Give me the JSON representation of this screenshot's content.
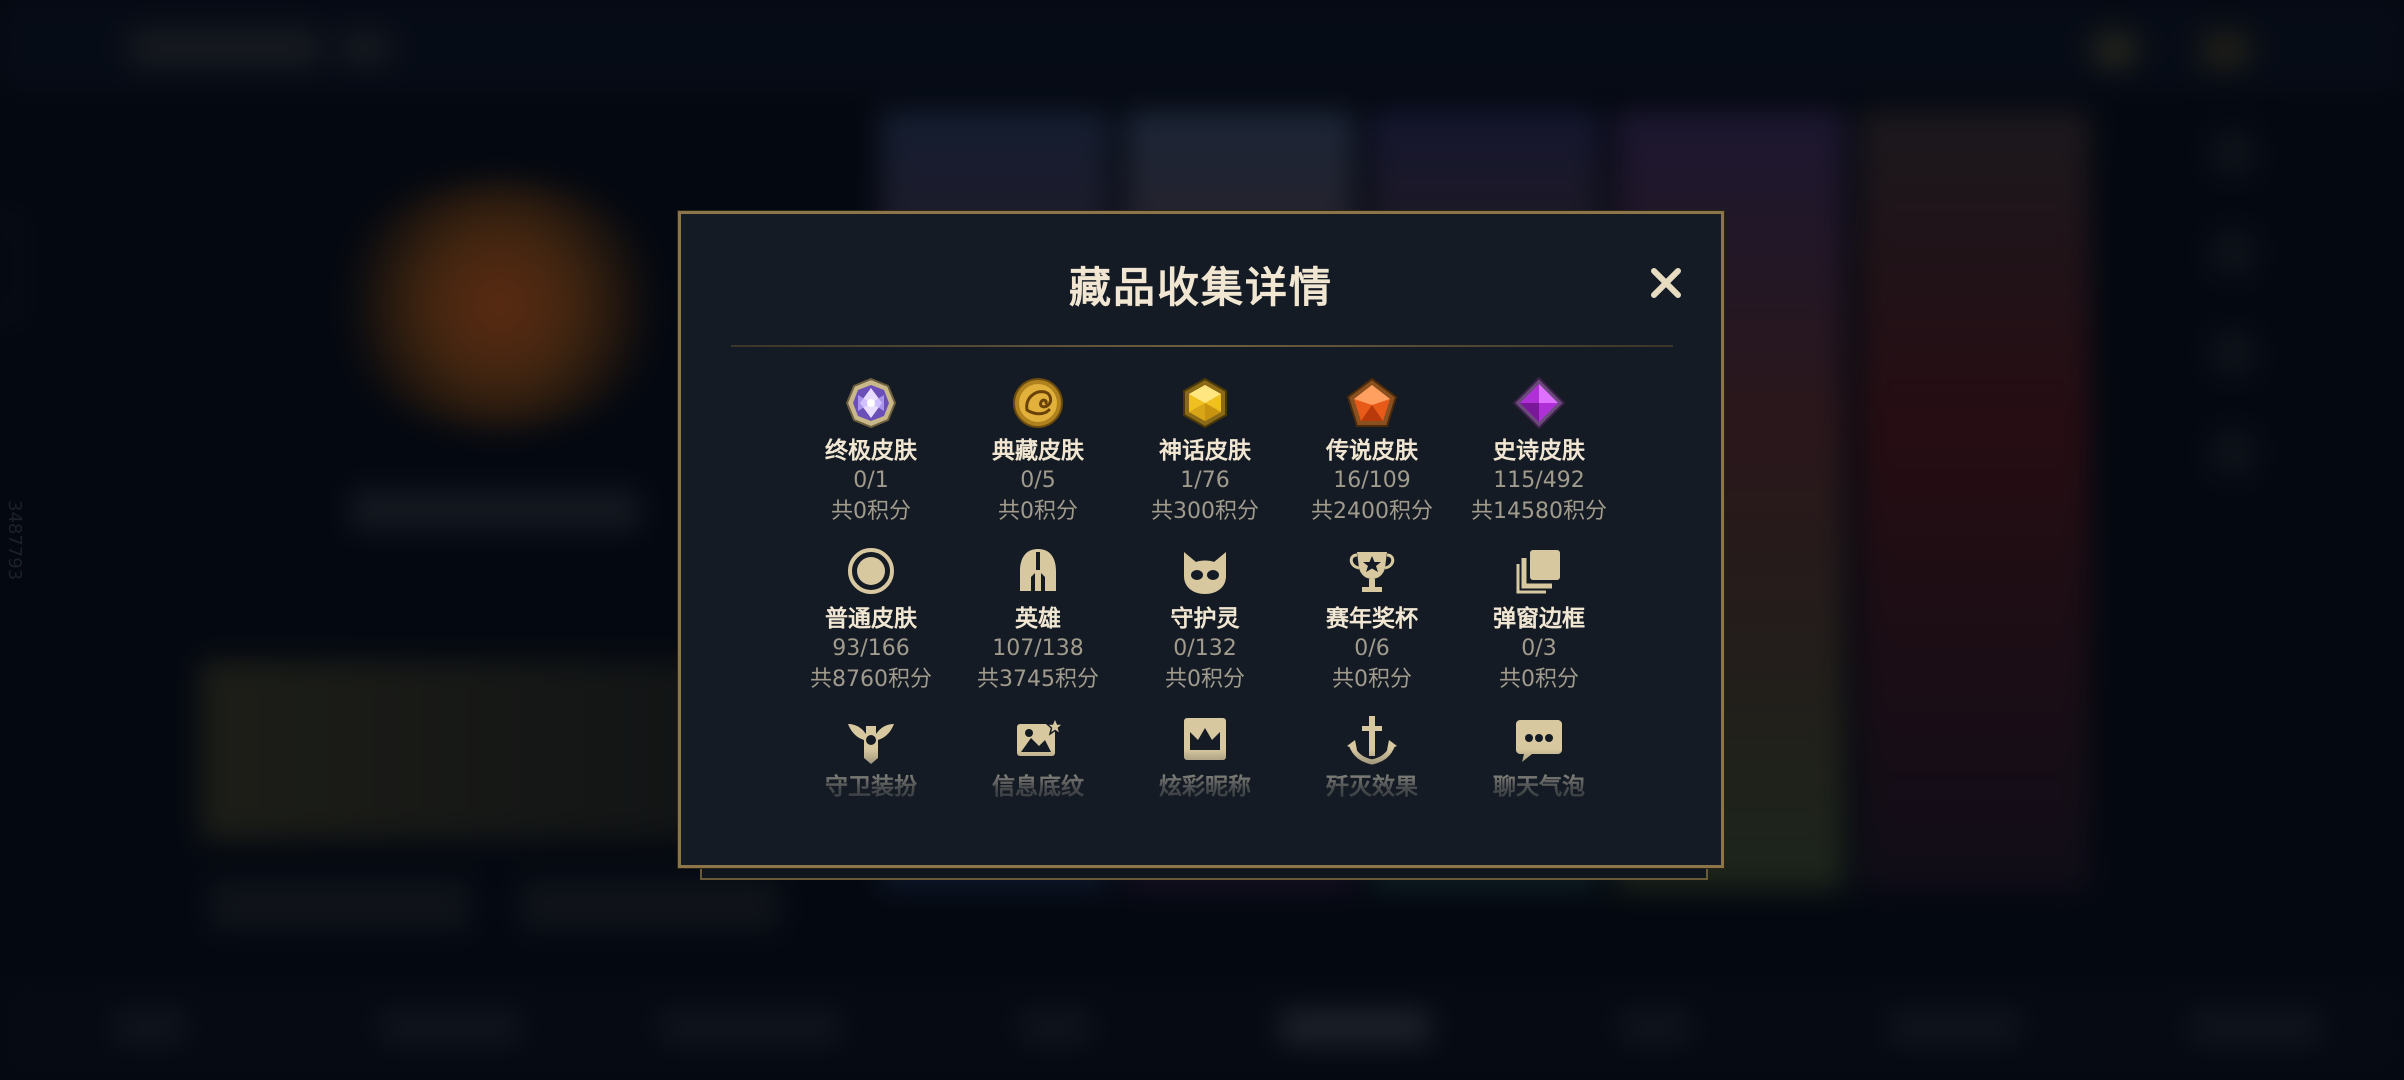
{
  "background": {
    "side_id": "3487793"
  },
  "modal": {
    "title": "藏品收集详情",
    "close_label": "✕",
    "items": [
      {
        "name": "终极皮肤",
        "count": "0/1",
        "points": "共0积分",
        "icon": "ultimate-gem-icon"
      },
      {
        "name": "典藏皮肤",
        "count": "0/5",
        "points": "共0积分",
        "icon": "dragon-coin-icon"
      },
      {
        "name": "神话皮肤",
        "count": "1/76",
        "points": "共300积分",
        "icon": "mythic-gem-icon"
      },
      {
        "name": "传说皮肤",
        "count": "16/109",
        "points": "共2400积分",
        "icon": "legendary-gem-icon"
      },
      {
        "name": "史诗皮肤",
        "count": "115/492",
        "points": "共14580积分",
        "icon": "epic-gem-icon"
      },
      {
        "name": "普通皮肤",
        "count": "93/166",
        "points": "共8760积分",
        "icon": "ring-icon"
      },
      {
        "name": "英雄",
        "count": "107/138",
        "points": "共3745积分",
        "icon": "helmet-icon"
      },
      {
        "name": "守护灵",
        "count": "0/132",
        "points": "共0积分",
        "icon": "companion-icon"
      },
      {
        "name": "赛年奖杯",
        "count": "0/6",
        "points": "共0积分",
        "icon": "trophy-icon"
      },
      {
        "name": "弹窗边框",
        "count": "0/3",
        "points": "共0积分",
        "icon": "frames-icon"
      },
      {
        "name": "守卫装扮",
        "count": "",
        "points": "",
        "icon": "ward-icon"
      },
      {
        "name": "信息底纹",
        "count": "",
        "points": "",
        "icon": "banner-icon"
      },
      {
        "name": "炫彩昵称",
        "count": "",
        "points": "",
        "icon": "crown-icon"
      },
      {
        "name": "歼灭效果",
        "count": "",
        "points": "",
        "icon": "anchor-icon"
      },
      {
        "name": "聊天气泡",
        "count": "",
        "points": "",
        "icon": "chat-bubble-icon"
      }
    ]
  }
}
